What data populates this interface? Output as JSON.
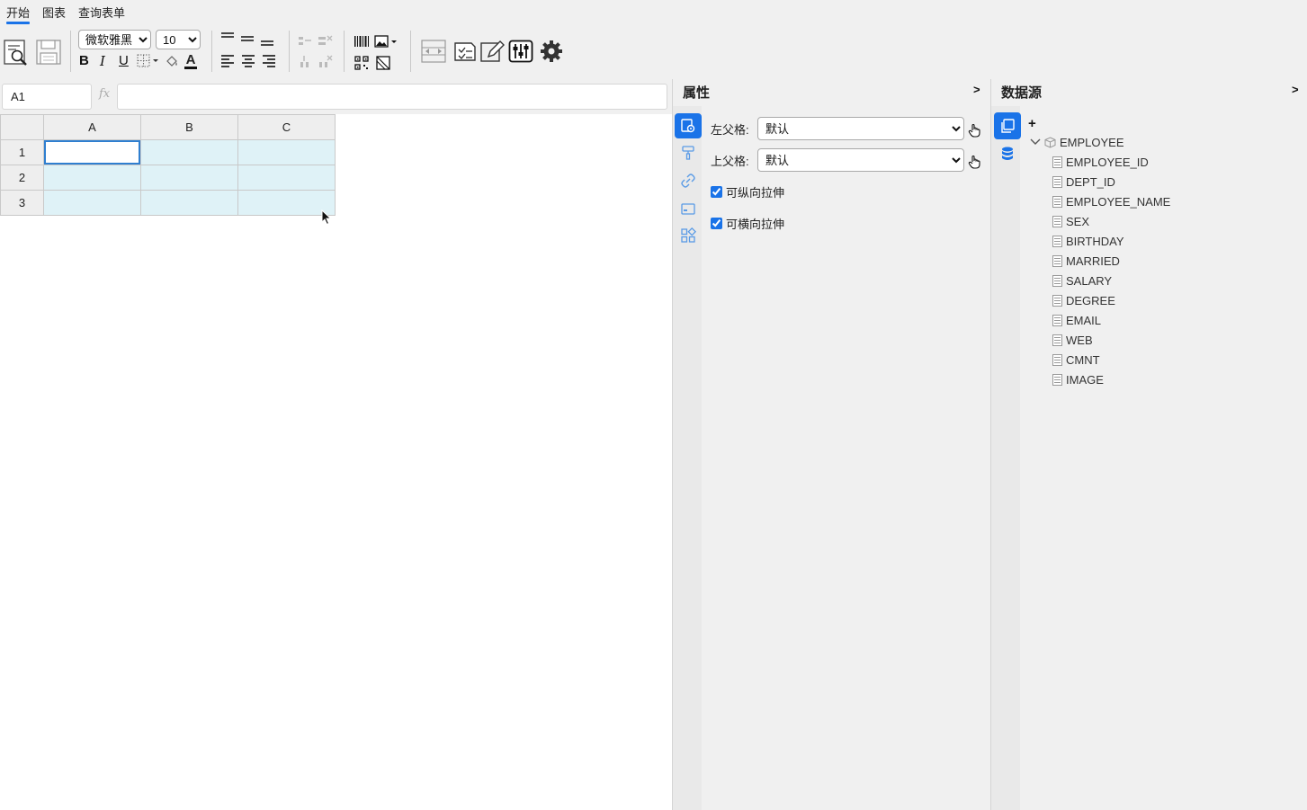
{
  "menu": {
    "tabs": [
      {
        "label": "开始",
        "active": true
      },
      {
        "label": "图表",
        "active": false
      },
      {
        "label": "查询表单",
        "active": false
      }
    ]
  },
  "toolbar": {
    "font_family": "微软雅黑",
    "font_size": "10",
    "bold_label": "B",
    "italic_label": "I",
    "underline_label": "U",
    "font_color_label": "A"
  },
  "formula_bar": {
    "cell_ref": "A1",
    "fx_label": "fx",
    "value": ""
  },
  "sheet": {
    "columns": [
      "A",
      "B",
      "C"
    ],
    "rows": [
      "1",
      "2",
      "3"
    ],
    "selected_cell": "A1",
    "selection_color": "#dff2f7",
    "active_border_color": "#2f7fd0"
  },
  "properties": {
    "title": "属性",
    "collapse_label": ">",
    "left_parent_label": "左父格:",
    "left_parent_value": "默认",
    "top_parent_label": "上父格:",
    "top_parent_value": "默认",
    "vertical_stretch_label": "可纵向拉伸",
    "vertical_stretch_checked": true,
    "horizontal_stretch_label": "可横向拉伸",
    "horizontal_stretch_checked": true,
    "side_icons": [
      "cell-settings-icon",
      "format-brush-icon",
      "link-icon",
      "display-icon",
      "widgets-icon"
    ]
  },
  "datasource": {
    "title": "数据源",
    "collapse_label": ">",
    "add_label": "+",
    "dataset_name": "EMPLOYEE",
    "fields": [
      "EMPLOYEE_ID",
      "DEPT_ID",
      "EMPLOYEE_NAME",
      "SEX",
      "BIRTHDAY",
      "MARRIED",
      "SALARY",
      "DEGREE",
      "EMAIL",
      "WEB",
      "CMNT",
      "IMAGE"
    ]
  },
  "colors": {
    "accent": "#1a73e8",
    "panel_bg": "#f0f0f0"
  }
}
